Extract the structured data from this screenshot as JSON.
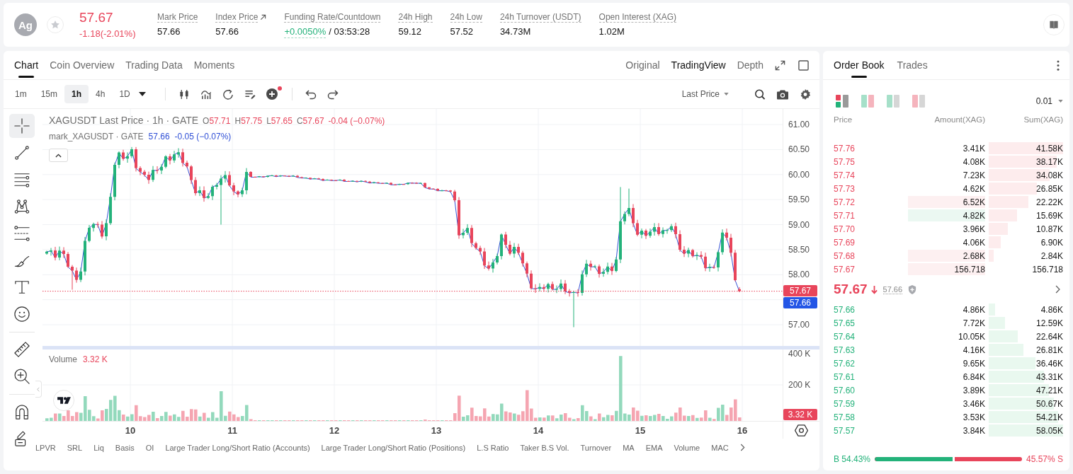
{
  "header": {
    "symbol": "Ag",
    "favorite": false,
    "price": "57.67",
    "change": "-1.18(-2.01%)",
    "falling": true,
    "stats": [
      {
        "kind": "plain",
        "label": "Mark Price",
        "value": "57.66"
      },
      {
        "kind": "link",
        "label": "Index Price",
        "value": "57.66"
      },
      {
        "kind": "funding",
        "label": "Funding Rate/Countdown",
        "value": "+0.0050%",
        "countdown": "/ 03:53:28"
      },
      {
        "kind": "plain",
        "label": "24h High",
        "value": "59.12"
      },
      {
        "kind": "plain",
        "label": "24h Low",
        "value": "57.52"
      },
      {
        "kind": "plain",
        "label": "24h Turnover (USDT)",
        "value": "34.73M"
      },
      {
        "kind": "plain",
        "label": "Open Interest (XAG)",
        "value": "1.02M"
      }
    ]
  },
  "chart_panel": {
    "tabs": [
      {
        "label": "Chart",
        "selected": true
      },
      {
        "label": "Coin Overview",
        "selected": false
      },
      {
        "label": "Trading Data",
        "selected": false
      },
      {
        "label": "Moments",
        "selected": false
      }
    ],
    "views": [
      {
        "label": "Original",
        "selected": false
      },
      {
        "label": "TradingView",
        "selected": true
      },
      {
        "label": "Depth",
        "selected": false
      }
    ],
    "intervals": [
      {
        "label": "1m",
        "selected": false
      },
      {
        "label": "15m",
        "selected": false
      },
      {
        "label": "1h",
        "selected": true
      },
      {
        "label": "4h",
        "selected": false
      },
      {
        "label": "1D",
        "selected": false
      }
    ],
    "price_source": "Last Price",
    "tool_groups": [
      {
        "tools": [
          {
            "kind": "crosshair",
            "selected": true
          },
          {
            "kind": "trendline",
            "selected": false
          },
          {
            "kind": "parallel",
            "selected": false
          },
          {
            "kind": "pattern",
            "selected": false
          },
          {
            "kind": "levels",
            "selected": false
          },
          {
            "kind": "brush",
            "selected": false
          },
          {
            "kind": "text",
            "selected": false
          },
          {
            "kind": "emoji",
            "selected": false
          }
        ]
      },
      {
        "tools": [
          {
            "kind": "ruler",
            "selected": false
          },
          {
            "kind": "zoom",
            "selected": false
          }
        ]
      },
      {
        "tools": [
          {
            "kind": "magnet",
            "selected": false
          },
          {
            "kind": "lock",
            "selected": false
          }
        ]
      }
    ],
    "legend": {
      "title": "XAGUSDT Last Price · 1h · GATE",
      "ohlc": [
        {
          "label": "O",
          "value": "57.71"
        },
        {
          "label": "H",
          "value": "57.75"
        },
        {
          "label": "L",
          "value": "57.65"
        },
        {
          "label": "C",
          "value": "57.67"
        }
      ],
      "change": "-0.04 (−0.07%)",
      "mark_title": "mark_XAGUSDT · GATE",
      "mark_value": "57.66",
      "mark_change": "-0.05 (−0.07%)"
    },
    "volume_legend": {
      "label": "Volume",
      "value": "3.32 K"
    },
    "price_ticks": [
      "61.00",
      "60.50",
      "60.00",
      "59.50",
      "59.00",
      "58.50",
      "58.00",
      "57.00"
    ],
    "volume_ticks": [
      "400 K",
      "200 K"
    ],
    "price_labels": [
      {
        "kind": "last",
        "value": "57.67"
      },
      {
        "kind": "mark",
        "value": "57.66"
      }
    ],
    "volume_label": "3.32 K",
    "time_ticks": [
      "10",
      "11",
      "12",
      "13",
      "14",
      "15",
      "16"
    ],
    "indicators": [
      "LPVR",
      "SRL",
      "Liq",
      "Basis",
      "OI",
      "Large Trader Long/Short Ratio (Accounts)",
      "Large Trader Long/Short Ratio (Positions)",
      "L.S Ratio",
      "Taker B.S Vol.",
      "Turnover",
      "MA",
      "EMA",
      "Volume",
      "MAC"
    ]
  },
  "order_book": {
    "tabs": [
      {
        "label": "Order Book",
        "selected": true
      },
      {
        "label": "Trades",
        "selected": false
      }
    ],
    "layouts": [
      {
        "kind": "both",
        "selected": true
      },
      {
        "kind": "split",
        "selected": false
      },
      {
        "kind": "bids",
        "selected": false
      },
      {
        "kind": "asks",
        "selected": false
      }
    ],
    "precision": "0.01",
    "columns": [
      "Price",
      "Amount(XAG)",
      "Sum(XAG)"
    ],
    "asks": [
      {
        "price": "57.76",
        "amount": "3.41K",
        "sum": "41.58K",
        "highlighted": false
      },
      {
        "price": "57.75",
        "amount": "4.08K",
        "sum": "38.17K",
        "highlighted": false
      },
      {
        "price": "57.74",
        "amount": "7.23K",
        "sum": "34.08K",
        "highlighted": false
      },
      {
        "price": "57.73",
        "amount": "4.62K",
        "sum": "26.85K",
        "highlighted": false
      },
      {
        "price": "57.72",
        "amount": "6.52K",
        "sum": "22.22K",
        "highlighted": true,
        "color": "#fdf0f1"
      },
      {
        "price": "57.71",
        "amount": "4.82K",
        "sum": "15.69K",
        "highlighted": true,
        "color": "#ebf8f2"
      },
      {
        "price": "57.70",
        "amount": "3.96K",
        "sum": "10.87K",
        "highlighted": false
      },
      {
        "price": "57.69",
        "amount": "4.06K",
        "sum": "6.90K",
        "highlighted": false
      },
      {
        "price": "57.68",
        "amount": "2.68K",
        "sum": "2.84K",
        "highlighted": true,
        "color": "#fdf0f1"
      },
      {
        "price": "57.67",
        "amount": "156.718",
        "sum": "156.718",
        "highlighted": true,
        "color": "#fdf0f1"
      }
    ],
    "last": {
      "price": "57.67",
      "falling": true,
      "mark": "57.66"
    },
    "bids": [
      {
        "price": "57.66",
        "amount": "4.86K",
        "sum": "4.86K",
        "highlighted": false
      },
      {
        "price": "57.65",
        "amount": "7.72K",
        "sum": "12.59K",
        "highlighted": false
      },
      {
        "price": "57.64",
        "amount": "10.05K",
        "sum": "22.64K",
        "highlighted": false
      },
      {
        "price": "57.63",
        "amount": "4.16K",
        "sum": "26.81K",
        "highlighted": false
      },
      {
        "price": "57.62",
        "amount": "9.65K",
        "sum": "36.46K",
        "highlighted": false
      },
      {
        "price": "57.61",
        "amount": "6.84K",
        "sum": "43.31K",
        "highlighted": false
      },
      {
        "price": "57.60",
        "amount": "3.89K",
        "sum": "47.21K",
        "highlighted": false
      },
      {
        "price": "57.59",
        "amount": "3.46K",
        "sum": "50.67K",
        "highlighted": false
      },
      {
        "price": "57.58",
        "amount": "3.53K",
        "sum": "54.21K",
        "highlighted": false
      },
      {
        "price": "57.57",
        "amount": "3.84K",
        "sum": "58.05K",
        "highlighted": false
      }
    ],
    "ratio": {
      "buy": "B 54.43%",
      "sell": "45.57% S",
      "level": 0.5443
    }
  }
}
